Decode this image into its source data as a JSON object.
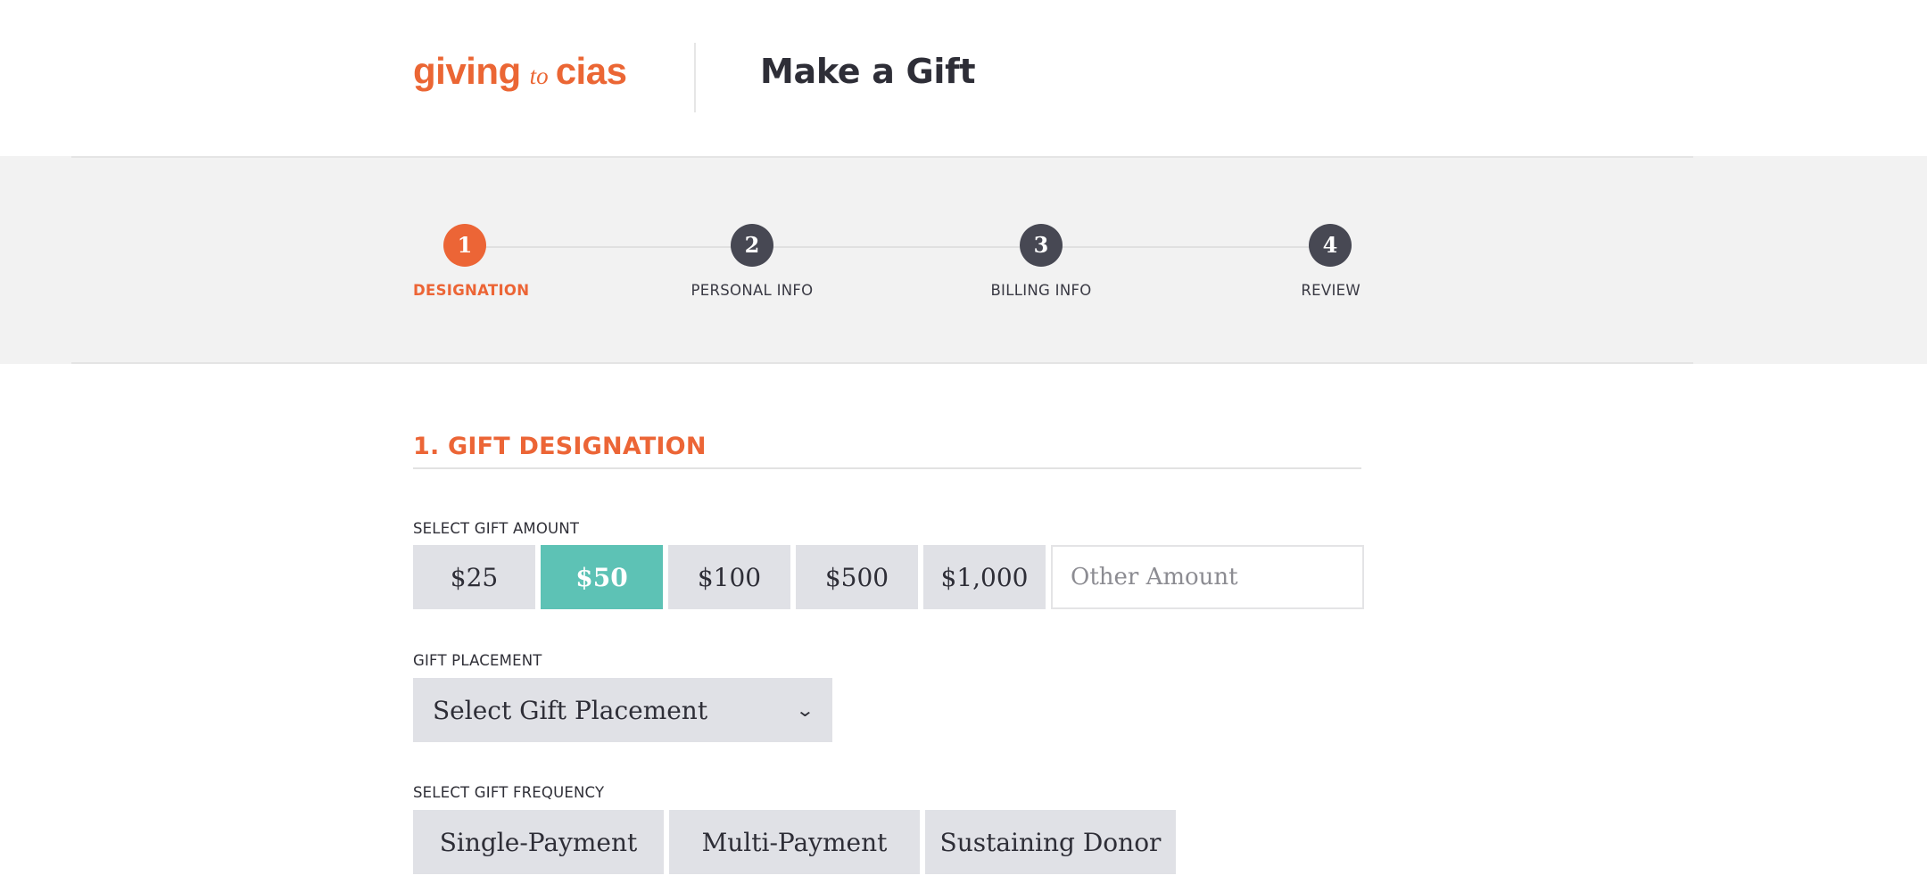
{
  "header": {
    "logo": {
      "word1": "giving",
      "connector": "to",
      "word2": "cias"
    },
    "title": "Make a Gift"
  },
  "stepper": {
    "steps": [
      {
        "number": "1",
        "label": "DESIGNATION",
        "active": true
      },
      {
        "number": "2",
        "label": "PERSONAL INFO",
        "active": false
      },
      {
        "number": "3",
        "label": "BILLING INFO",
        "active": false
      },
      {
        "number": "4",
        "label": "REVIEW",
        "active": false
      }
    ]
  },
  "form": {
    "section_heading": "1. GIFT DESIGNATION",
    "gift_amount": {
      "label": "SELECT GIFT AMOUNT",
      "options": [
        "$25",
        "$50",
        "$100",
        "$500",
        "$1,000"
      ],
      "selected": "$50",
      "other_placeholder": "Other Amount",
      "other_value": ""
    },
    "gift_placement": {
      "label": "GIFT PLACEMENT",
      "selected_value": "Select Gift Placement",
      "icon": "chevron-down-icon"
    },
    "gift_frequency": {
      "label": "SELECT GIFT FREQUENCY",
      "options": [
        "Single-Payment",
        "Multi-Payment",
        "Sustaining Donor"
      ]
    }
  },
  "colors": {
    "brand_orange": "#ec6536",
    "selected_teal": "#5dc2b5",
    "step_dark": "#474853",
    "button_gray": "#e0e1e6",
    "band_gray": "#f2f2f2"
  }
}
